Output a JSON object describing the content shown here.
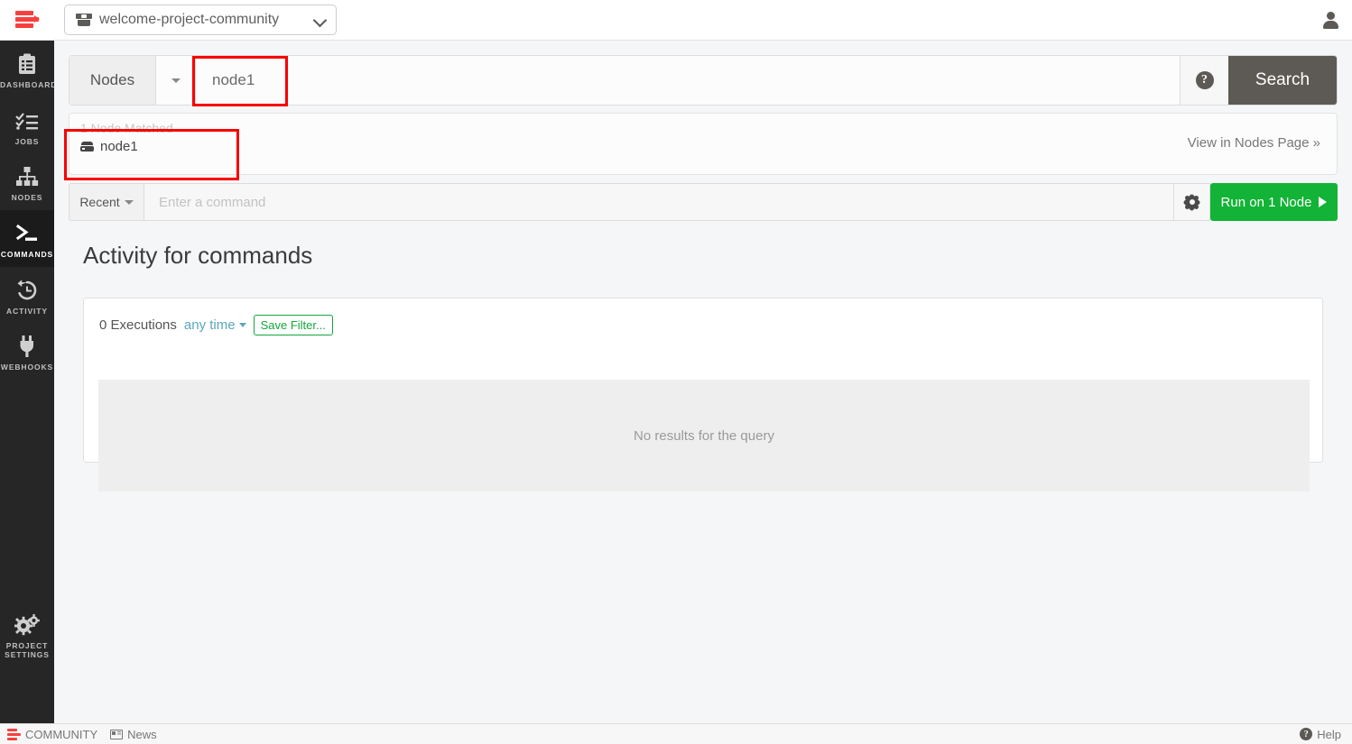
{
  "topbar": {
    "logo": "rundeck-logo",
    "project_selector": {
      "icon": "project-box-icon",
      "value": "welcome-project-community",
      "caret": "chevron-down-icon"
    },
    "settings_icon": "gear-icon",
    "user_icon": "user-icon"
  },
  "sidebar": {
    "items": [
      {
        "label": "DASHBOARD",
        "icon": "clipboard-list-icon",
        "active": false
      },
      {
        "label": "JOBS",
        "icon": "checklist-icon",
        "active": false
      },
      {
        "label": "NODES",
        "icon": "sitemap-icon",
        "active": false
      },
      {
        "label": "COMMANDS",
        "icon": "terminal-icon",
        "active": true
      },
      {
        "label": "ACTIVITY",
        "icon": "history-clock-icon",
        "active": false
      },
      {
        "label": "WEBHOOKS",
        "icon": "plug-icon",
        "active": false
      }
    ],
    "bottom": {
      "label": "PROJECT\nSETTINGS",
      "label_line1": "PROJECT",
      "label_line2": "SETTINGS",
      "icon": "gears-icon"
    }
  },
  "search": {
    "type_label": "Nodes",
    "type_caret": "caret-down-icon",
    "query_value": "node1",
    "query_placeholder": "",
    "help_icon": "question-circle-icon",
    "search_button": "Search"
  },
  "matched": {
    "title": "1 Node Matched",
    "node_icon": "server-icon",
    "node_name": "node1",
    "view_link": "View in Nodes Page »"
  },
  "command_bar": {
    "recent_label": "Recent",
    "recent_caret": "caret-down-icon",
    "command_value": "",
    "command_placeholder": "Enter a command",
    "settings_icon": "gear-icon",
    "run_label": "Run on 1 Node",
    "run_icon": "play-icon"
  },
  "activity": {
    "page_title": "Activity for commands",
    "executions_count": "0 Executions",
    "time_filter": "any time",
    "time_filter_caret": "caret-down-icon",
    "save_filter": "Save Filter...",
    "empty_message": "No results for the query"
  },
  "footer": {
    "logo": "rundeck-logo-small",
    "community": "COMMUNITY",
    "news_icon": "news-icon",
    "news": "News",
    "help_icon": "question-circle-icon",
    "help": "Help"
  },
  "colors": {
    "accent_red": "#f73f3f",
    "run_green": "#12b336",
    "save_filter_green": "#12a83a",
    "time_filter_teal": "#5aa7bc",
    "search_button_gray": "#5d5a55",
    "sidebar_dark": "#262626",
    "annotation_red": "#f70000"
  }
}
